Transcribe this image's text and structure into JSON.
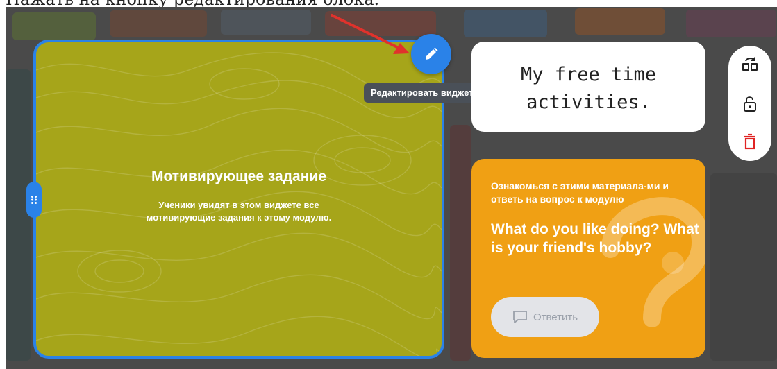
{
  "caption": "Нажать на кнопку редактирования блока.",
  "main_widget": {
    "title": "Мотивирующее задание",
    "subtitle": "Ученики увидят в этом виджете все мотивирующие задания к этому модулю."
  },
  "edit_tooltip": "Редактировать виджет",
  "title_widget": {
    "line1": "My free time",
    "line2": "activities."
  },
  "question_widget": {
    "hint": "Ознакомься с этими материала-ми и ответь на вопрос к модулю",
    "question": "What do you like doing? What is your friend's hobby?",
    "answer_label": "Ответить"
  },
  "toolbar": {
    "items": [
      {
        "icon": "swap-icon"
      },
      {
        "icon": "unlock-icon"
      },
      {
        "icon": "trash-icon"
      }
    ]
  },
  "colors": {
    "accent": "#2a82e8",
    "main_widget": "#a6a51a",
    "question_widget": "#f0a014",
    "delete": "#e02424"
  }
}
